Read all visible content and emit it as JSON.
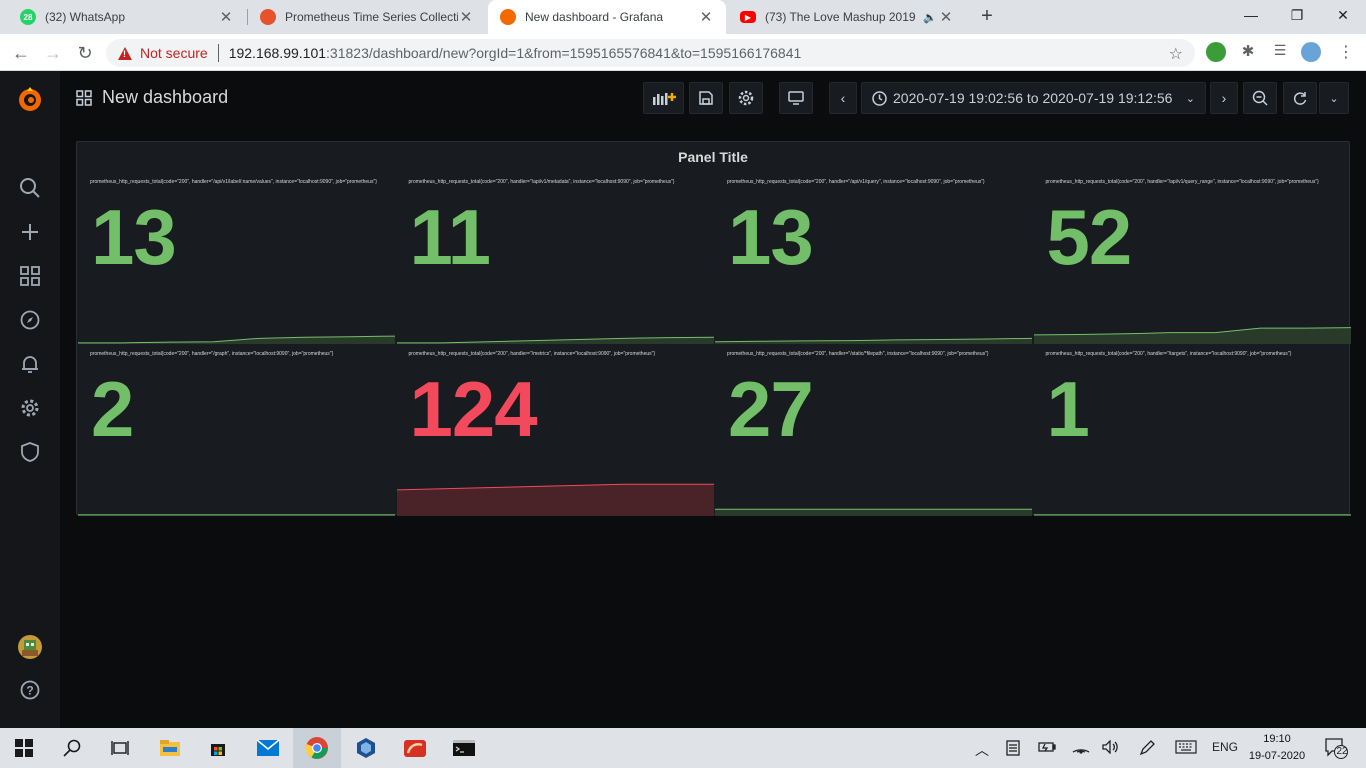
{
  "browser": {
    "tabs": [
      {
        "title": "(32) WhatsApp",
        "favicon_badge": "28",
        "color": "#25d366"
      },
      {
        "title": "Prometheus Time Series Collecti",
        "color": "#e6522c"
      },
      {
        "title": "New dashboard - Grafana",
        "color": "#f46800"
      },
      {
        "title": "(73) The Love Mashup 2019",
        "color": "#ff0000"
      }
    ],
    "active_tab": 2,
    "security_label": "Not secure",
    "url_host": "192.168.99.101",
    "url_rest": ":31823/dashboard/new?orgId=1&from=1595165576841&to=1595166176841"
  },
  "grafana": {
    "dashboard_title": "New dashboard",
    "time_range": "2020-07-19 19:02:56 to 2020-07-19 19:12:56",
    "sidebar_icons": [
      "grafana-logo-icon",
      "search-icon",
      "plus-icon",
      "dashboards-icon",
      "explore-icon",
      "alerting-icon",
      "configuration-icon",
      "shield-icon",
      "user-avatar-icon",
      "help-icon"
    ],
    "panel_title": "Panel Title",
    "stats": [
      {
        "label": "prometheus_http_requests_total{code=\"200\", handler=\"/api/v1/label/:name/values\", instance=\"localhost:9090\", job=\"prometheus\"}",
        "value": "13",
        "status": "ok",
        "trend": [
          0.05,
          0.05,
          0.08,
          0.1,
          0.25,
          0.3,
          0.32,
          0.35
        ]
      },
      {
        "label": "prometheus_http_requests_total{code=\"200\", handler=\"/api/v1/metadata\", instance=\"localhost:9090\", job=\"prometheus\"}",
        "value": "11",
        "status": "ok",
        "trend": [
          0.05,
          0.05,
          0.1,
          0.15,
          0.2,
          0.25,
          0.28,
          0.3
        ]
      },
      {
        "label": "prometheus_http_requests_total{code=\"200\", handler=\"/api/v1/query\", instance=\"localhost:9090\", job=\"prometheus\"}",
        "value": "13",
        "status": "ok",
        "trend": [
          0.1,
          0.12,
          0.14,
          0.15,
          0.18,
          0.2,
          0.22,
          0.25
        ]
      },
      {
        "label": "prometheus_http_requests_total{code=\"200\", handler=\"/api/v1/query_range\", instance=\"localhost:9090\", job=\"prometheus\"}",
        "value": "52",
        "status": "ok",
        "trend": [
          0.4,
          0.42,
          0.45,
          0.5,
          0.5,
          0.7,
          0.7,
          0.72
        ]
      },
      {
        "label": "prometheus_http_requests_total{code=\"200\", handler=\"/graph\", instance=\"localhost:9090\", job=\"prometheus\"}",
        "value": "2",
        "status": "ok",
        "trend": [
          0.05,
          0.05,
          0.05,
          0.05,
          0.05,
          0.05,
          0.05,
          0.05
        ]
      },
      {
        "label": "prometheus_http_requests_total{code=\"200\", handler=\"/metrics\", instance=\"localhost:9090\", job=\"prometheus\"}",
        "value": "124",
        "status": "warn",
        "trend": [
          1.15,
          1.2,
          1.25,
          1.3,
          1.35,
          1.4,
          1.4,
          1.4
        ]
      },
      {
        "label": "prometheus_http_requests_total{code=\"200\", handler=\"/static/*filepath\", instance=\"localhost:9090\", job=\"prometheus\"}",
        "value": "27",
        "status": "ok",
        "trend": [
          0.3,
          0.3,
          0.3,
          0.3,
          0.3,
          0.3,
          0.3,
          0.3
        ]
      },
      {
        "label": "prometheus_http_requests_total{code=\"200\", handler=\"/targets\", instance=\"localhost:9090\", job=\"prometheus\"}",
        "value": "1",
        "status": "ok",
        "trend": [
          0.05,
          0.05,
          0.05,
          0.05,
          0.05,
          0.05,
          0.05,
          0.05
        ]
      }
    ],
    "colors": {
      "ok": "#73bf69",
      "warn": "#f2495c",
      "ok_fill": "#2a3a2a",
      "warn_fill": "#4a2328"
    }
  },
  "taskbar": {
    "language": "ENG",
    "time": "19:10",
    "date": "19-07-2020",
    "notifications": "22"
  }
}
